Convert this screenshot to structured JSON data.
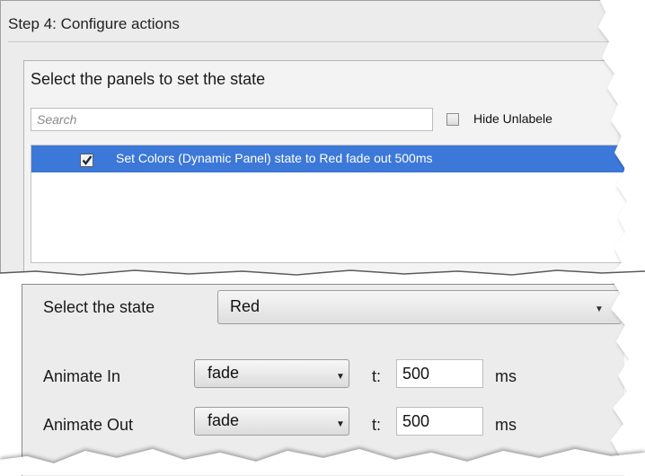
{
  "step": {
    "title": "Step 4: Configure actions"
  },
  "panels": {
    "label": "Select the panels to set the state",
    "search_placeholder": "Search",
    "hide_unlabeled_label": "Hide Unlabele",
    "hide_unlabeled_checked": false,
    "items": [
      {
        "label": "Set Colors (Dynamic Panel) state to Red fade out 500ms",
        "checked": true,
        "selected": true
      }
    ]
  },
  "state": {
    "label": "Select the state",
    "selected": "Red"
  },
  "animate_in": {
    "label": "Animate In",
    "effect": "fade",
    "t_label": "t:",
    "duration": "500",
    "unit": "ms"
  },
  "animate_out": {
    "label": "Animate Out",
    "effect": "fade",
    "t_label": "t:",
    "duration": "500",
    "unit": "ms"
  },
  "colors": {
    "selection": "#3c78d8",
    "panel_bg": "#ececec"
  }
}
